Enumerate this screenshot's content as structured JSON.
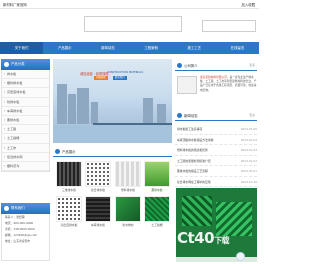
{
  "topbar": {
    "site_title": "新材料厂家官网",
    "favorite": "加入收藏"
  },
  "nav": [
    "关于我们",
    "产品展示",
    "新闻动态",
    "工程案例",
    "施工工艺",
    "在线留言"
  ],
  "sidebar": {
    "title": "产品分类",
    "items": [
      "排水板",
      "塑料排水板",
      "高密度排水板",
      "防排水板",
      "车库排水板",
      "蓄排水板",
      "土工膜",
      "土工格栅",
      "土工布",
      "复合排水网",
      "塑料盲沟"
    ]
  },
  "contact": {
    "title": "联系我们",
    "lines": [
      "联系人：张经理",
      "电话：400-000-0000",
      "手机：138 0000 0000",
      "邮箱：123456@qq.com",
      "地址：山东省泰安市"
    ]
  },
  "hero": {
    "headline": "诚信经营 · 品质保障",
    "sub": "CONSTRUCTION MATERIALS",
    "button_a": "详细查看",
    "button_b": "联系我们"
  },
  "products": {
    "title": "产品展示",
    "items": [
      "三维排水板",
      "复合排水板",
      "塑料排水板",
      "蓄排水板",
      "高密度排水板",
      "车库排水板",
      "防水卷材",
      "土工格栅"
    ]
  },
  "about": {
    "title": "公司简介",
    "more": "更多",
    "text_prefix": "泰安某新材料有限公司，",
    "text_body": "是一家专业生产排水板、土工膜、土工布等新型建筑材料的企业，产品广泛应用于各类工程项目，质量可靠，欢迎来电咨询。"
  },
  "news": {
    "title": "新闻动态",
    "more": "更多",
    "items": [
      {
        "title": "排水板施工注意事项",
        "date": "2024-01-05"
      },
      {
        "title": "车库顶板排水板铺设方法详解",
        "date": "2024-01-04"
      },
      {
        "title": "塑料排水板的用途和优势",
        "date": "2024-01-03"
      },
      {
        "title": "土工膜的质量检测标准介绍",
        "date": "2024-01-02"
      },
      {
        "title": "蓄排水板的铺设工艺流程",
        "date": "2024-01-01"
      },
      {
        "title": "复合排水网在工程中的应用",
        "date": "2023-12-30"
      }
    ]
  },
  "watermark": {
    "latin": "Ct40",
    "cn": "下载"
  }
}
